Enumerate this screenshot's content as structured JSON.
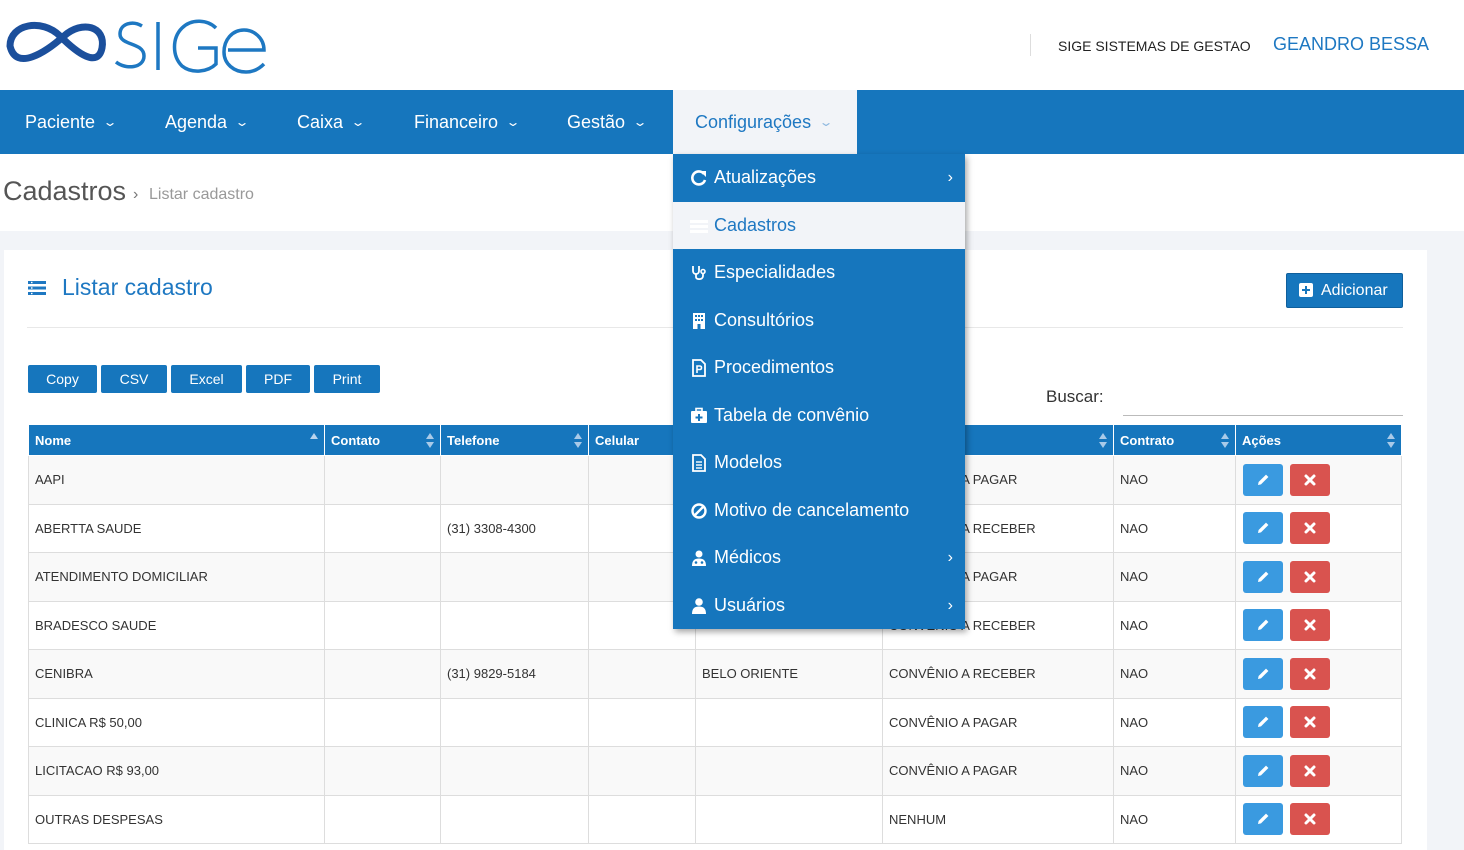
{
  "header": {
    "logo_text": "SIGE",
    "company": "SIGE SISTEMAS DE GESTAO",
    "user": "GEANDRO BESSA"
  },
  "nav": {
    "items": [
      {
        "label": "Paciente"
      },
      {
        "label": "Agenda"
      },
      {
        "label": "Caixa"
      },
      {
        "label": "Financeiro"
      },
      {
        "label": "Gestão"
      },
      {
        "label": "Configurações",
        "active": true
      }
    ]
  },
  "breadcrumb": {
    "title": "Cadastros",
    "separator": "›",
    "current": "Listar cadastro"
  },
  "panel": {
    "title": "Listar cadastro",
    "add_label": "Adicionar",
    "export_buttons": [
      "Copy",
      "CSV",
      "Excel",
      "PDF",
      "Print"
    ],
    "search_label": "Buscar:",
    "search_value": ""
  },
  "table": {
    "columns": [
      "Nome",
      "Contato",
      "Telefone",
      "Celular",
      "",
      "",
      "Contrato",
      "Ações"
    ],
    "rows": [
      {
        "nome": "AAPI",
        "contato": "",
        "telefone": "",
        "celular": "",
        "cidade": "",
        "tipo": "CONVÊNIO A PAGAR",
        "contrato": "NAO"
      },
      {
        "nome": "ABERTTA SAUDE",
        "contato": "",
        "telefone": "(31) 3308-4300",
        "celular": "",
        "cidade": "",
        "tipo": "CONVÊNIO A RECEBER",
        "contrato": "NAO"
      },
      {
        "nome": "ATENDIMENTO DOMICILIAR",
        "contato": "",
        "telefone": "",
        "celular": "",
        "cidade": "",
        "tipo": "CONVÊNIO A PAGAR",
        "contrato": "NAO"
      },
      {
        "nome": "BRADESCO SAUDE",
        "contato": "",
        "telefone": "",
        "celular": "",
        "cidade": "",
        "tipo": "CONVÊNIO A RECEBER",
        "contrato": "NAO"
      },
      {
        "nome": "CENIBRA",
        "contato": "",
        "telefone": "(31) 9829-5184",
        "celular": "",
        "cidade": "BELO ORIENTE",
        "tipo": "CONVÊNIO A RECEBER",
        "contrato": "NAO"
      },
      {
        "nome": "CLINICA R$ 50,00",
        "contato": "",
        "telefone": "",
        "celular": "",
        "cidade": "",
        "tipo": "CONVÊNIO A PAGAR",
        "contrato": "NAO"
      },
      {
        "nome": "LICITACAO R$ 93,00",
        "contato": "",
        "telefone": "",
        "celular": "",
        "cidade": "",
        "tipo": "CONVÊNIO A PAGAR",
        "contrato": "NAO"
      },
      {
        "nome": "OUTRAS DESPESAS",
        "contato": "",
        "telefone": "",
        "celular": "",
        "cidade": "",
        "tipo": "NENHUM",
        "contrato": "NAO"
      }
    ]
  },
  "dropdown": {
    "items": [
      {
        "label": "Atualizações",
        "icon": "refresh-icon",
        "submenu": true
      },
      {
        "label": "Cadastros",
        "icon": "list-icon",
        "active": true
      },
      {
        "label": "Especialidades",
        "icon": "stethoscope-icon"
      },
      {
        "label": "Consultórios",
        "icon": "building-icon"
      },
      {
        "label": "Procedimentos",
        "icon": "document-p-icon"
      },
      {
        "label": "Tabela de convênio",
        "icon": "medkit-icon"
      },
      {
        "label": "Modelos",
        "icon": "file-text-icon"
      },
      {
        "label": "Motivo de cancelamento",
        "icon": "ban-icon"
      },
      {
        "label": "Médicos",
        "icon": "doctor-icon",
        "submenu": true
      },
      {
        "label": "Usuários",
        "icon": "user-icon",
        "submenu": true
      }
    ]
  },
  "colors": {
    "brand_blue": "#1676bd",
    "link_blue": "#1e78c2",
    "edit_blue": "#3a9ae0",
    "delete_red": "#d9534f"
  }
}
